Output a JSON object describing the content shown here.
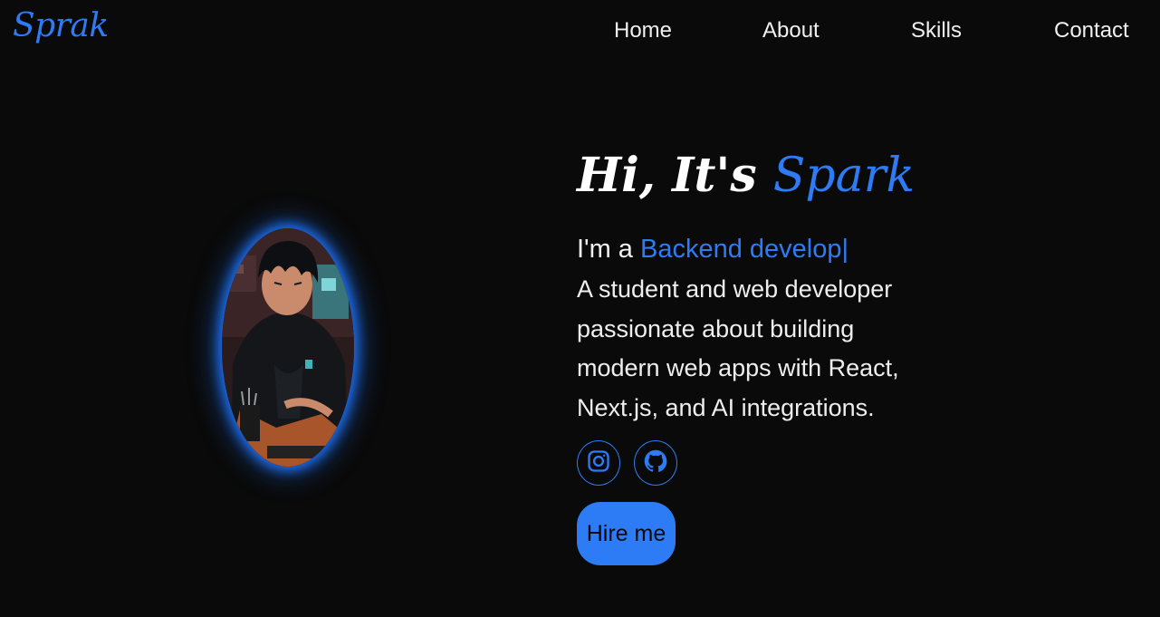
{
  "header": {
    "logo": "Sprak",
    "nav": [
      "Home",
      "About",
      "Skills",
      "Contact"
    ]
  },
  "hero": {
    "greeting": "Hi, It's",
    "name": "Spark",
    "role_prefix": "I'm a",
    "role_typed": "Backend develop|",
    "description": "A student and web developer passionate about building modern web apps with React, Next.js, and AI integrations.",
    "hire_label": "Hire me"
  },
  "socials": [
    {
      "icon": "instagram-icon"
    },
    {
      "icon": "github-icon"
    }
  ],
  "colors": {
    "background": "#0a0a0a",
    "accent": "#2d7cf6",
    "text": "#f2f2f2"
  }
}
